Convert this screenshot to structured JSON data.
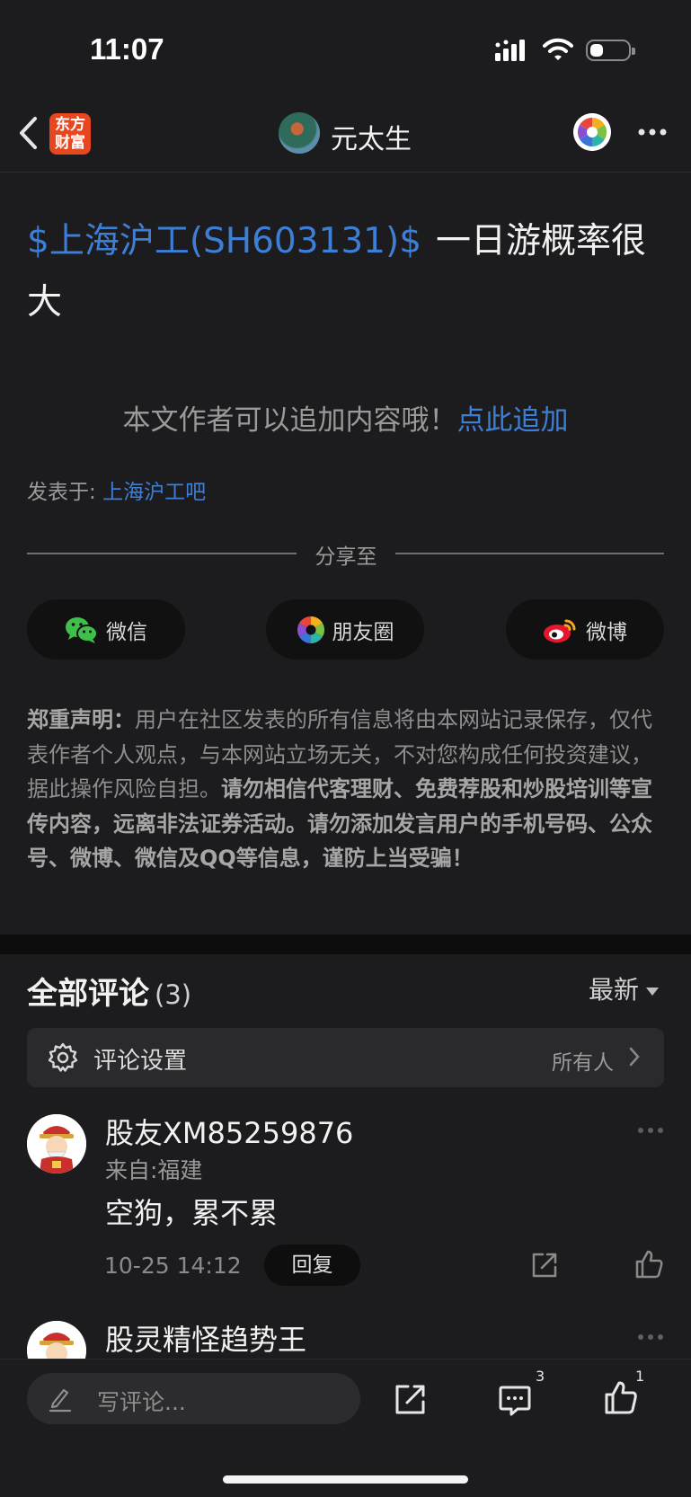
{
  "status_bar": {
    "time": "11:07"
  },
  "nav": {
    "logo_line1": "东方",
    "logo_line2": "财富",
    "author_name": "元太生"
  },
  "post": {
    "stock_tag": "$上海沪工(SH603131)$",
    "text": "一日游概率很大",
    "append_prompt": "本文作者可以追加内容哦！",
    "append_link": "点此追加",
    "posted_prefix": "发表于:",
    "posted_bar": "上海沪工吧"
  },
  "share": {
    "title": "分享至",
    "wechat": "微信",
    "moments": "朋友圈",
    "weibo": "微博"
  },
  "disclaimer": {
    "label": "郑重声明：",
    "normal": "用户在社区发表的所有信息将由本网站记录保存，仅代表作者个人观点，与本网站立场无关，不对您构成任何投资建议，据此操作风险自担。",
    "bold": "请勿相信代客理财、免费荐股和炒股培训等宣传内容，远离非法证券活动。请勿添加发言用户的手机号码、公众号、微博、微信及QQ等信息，谨防上当受骗！"
  },
  "comments": {
    "title": "全部评论",
    "count": "(3)",
    "sort": "最新",
    "settings_label": "评论设置",
    "settings_value": "所有人",
    "items": [
      {
        "user": "股友XM85259876",
        "from": "来自:福建",
        "text": "空狗，累不累",
        "time": "10-25 14:12",
        "reply": "回复"
      },
      {
        "user": "股灵精怪趋势王"
      }
    ]
  },
  "bottom": {
    "placeholder": "写评论...",
    "comment_count": "3",
    "like_count": "1"
  }
}
